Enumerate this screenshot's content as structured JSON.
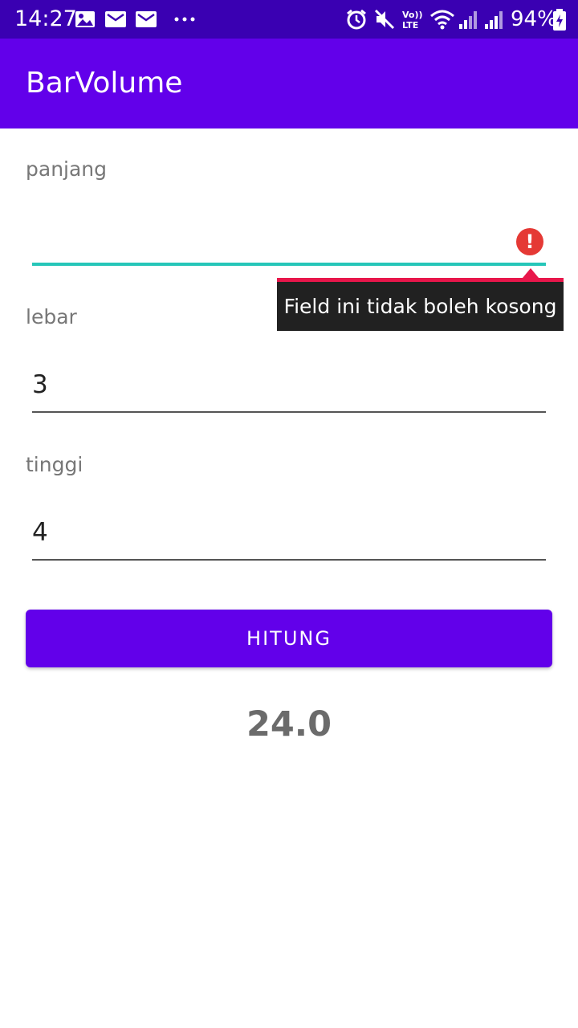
{
  "status_bar": {
    "time": "14:27",
    "battery_percent": "94%",
    "left_icons": [
      "image-icon",
      "mail-icon",
      "mail-icon",
      "more-icon"
    ],
    "right_icons": [
      "alarm-icon",
      "mute-icon",
      "volte-icon",
      "wifi-icon",
      "signal-icon",
      "signal-icon",
      "battery-charging-icon"
    ],
    "volte_text": "Vo)) LTE"
  },
  "app_bar": {
    "title": "BarVolume",
    "color": "#6200ea"
  },
  "form": {
    "panjang": {
      "label": "panjang",
      "value": "",
      "error": "Field ini tidak boleh kosong"
    },
    "lebar": {
      "label": "lebar",
      "value": "3"
    },
    "tinggi": {
      "label": "tinggi",
      "value": "4"
    }
  },
  "button": {
    "label": "HITUNG"
  },
  "result": {
    "value": "24.0"
  },
  "colors": {
    "accent": "#6200ea",
    "status_bar": "#3a00b2",
    "focus_line": "#26c6b8",
    "error": "#e53935"
  }
}
